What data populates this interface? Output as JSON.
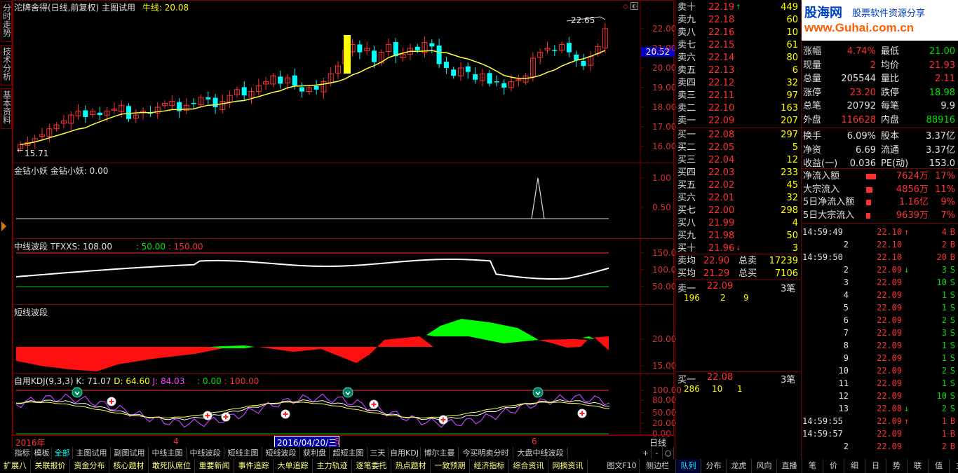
{
  "left_tabs": [
    "分时走势",
    "技术分析",
    "基本资料"
  ],
  "main_panel": {
    "header_stock": "沱牌舍得(日线,前复权)",
    "header_mode": "主图试用",
    "header_ma_label": "牛线:",
    "header_ma_value": "20.08",
    "high_label": "22.65",
    "low_label": "15.71",
    "price_tag": "20.52",
    "y_ticks": [
      "22.00",
      "21.00",
      "20.00",
      "19.00",
      "18.00",
      "17.00",
      "16.00"
    ]
  },
  "panel_jz": {
    "title": "金钻小妖  金钻小妖: 0.00",
    "y_ticks": [
      "1.00",
      "0.50"
    ]
  },
  "panel_mid": {
    "title": "中线波段  TFXXS: 108.00",
    "v1": ": 50.00",
    "v2": ": 150.00",
    "y_ticks": [
      "150.0",
      "100.0",
      "50.00"
    ]
  },
  "panel_short": {
    "title": "短线波段",
    "y_ticks": [
      "20.00",
      "15.00"
    ]
  },
  "panel_kdj": {
    "title": "自用KDJ(9,3,3)",
    "k": "K: 71.07",
    "d": "D: 64.60",
    "j": "J: 84.03",
    "v1": ": 0.00",
    "v2": ": 100.00",
    "y_ticks": [
      "100.00",
      "80.00",
      "50.00",
      "20.00",
      "0.00"
    ]
  },
  "date_axis": {
    "year": "2016年",
    "m4": "4",
    "cursor": "2016/04/20/三",
    "m5": "5",
    "m6": "6",
    "period": "日线"
  },
  "chart_data": {
    "type": "candlestick",
    "approx_close": [
      16.1,
      16.2,
      16.4,
      16.6,
      16.9,
      17.1,
      17.3,
      17.6,
      17.8,
      17.5,
      17.8,
      17.6,
      17.8,
      17.9,
      18.1,
      17.4,
      17.6,
      17.8,
      17.7,
      18.0,
      18.2,
      18.3,
      17.8,
      18.1,
      18.2,
      18.5,
      18.4,
      18.0,
      18.3,
      18.6,
      18.9,
      18.6,
      18.8,
      19.1,
      19.3,
      19.6,
      19.2,
      19.5,
      19.1,
      18.8,
      19.0,
      18.9,
      19.3,
      19.7,
      20.1,
      20.9,
      21.2,
      20.8,
      21.0,
      20.3,
      20.8,
      21.2,
      20.6,
      20.7,
      21.0,
      20.9,
      21.3,
      21.1,
      20.2,
      20.0,
      19.6,
      20.0,
      19.8,
      19.4,
      19.7,
      19.2,
      19.3,
      19.0,
      19.3,
      19.4,
      19.6,
      20.5,
      20.8,
      21.0,
      20.9,
      21.2,
      20.8,
      20.4,
      20.1,
      20.6,
      21.1,
      22.0
    ],
    "ma_label": "牛线",
    "kdj_extremes": {
      "top_markers": 3,
      "bottom_markers": 7
    }
  },
  "orderbook": {
    "sell": [
      {
        "label": "卖十",
        "price": "22.19",
        "vol": "449",
        "arrow": "↑"
      },
      {
        "label": "卖九",
        "price": "22.18",
        "vol": "60"
      },
      {
        "label": "卖八",
        "price": "22.16",
        "vol": "10"
      },
      {
        "label": "卖七",
        "price": "22.15",
        "vol": "61"
      },
      {
        "label": "卖六",
        "price": "22.14",
        "vol": "80"
      },
      {
        "label": "卖五",
        "price": "22.13",
        "vol": "6"
      },
      {
        "label": "卖四",
        "price": "22.12",
        "vol": "32"
      },
      {
        "label": "卖三",
        "price": "22.11",
        "vol": "97"
      },
      {
        "label": "卖二",
        "price": "22.10",
        "vol": "163"
      },
      {
        "label": "卖一",
        "price": "22.09",
        "vol": "207"
      }
    ],
    "buy": [
      {
        "label": "买一",
        "price": "22.08",
        "vol": "297"
      },
      {
        "label": "买二",
        "price": "22.05",
        "vol": "5"
      },
      {
        "label": "买三",
        "price": "22.04",
        "vol": "12"
      },
      {
        "label": "买四",
        "price": "22.03",
        "vol": "233"
      },
      {
        "label": "买五",
        "price": "22.02",
        "vol": "45"
      },
      {
        "label": "买六",
        "price": "22.01",
        "vol": "32"
      },
      {
        "label": "买七",
        "price": "22.00",
        "vol": "298"
      },
      {
        "label": "买八",
        "price": "21.99",
        "vol": "4"
      },
      {
        "label": "买九",
        "price": "21.98",
        "vol": "50"
      },
      {
        "label": "买十",
        "price": "21.96",
        "vol": "3",
        "arrow": "↓"
      }
    ],
    "avg_sell_label": "卖均",
    "avg_sell": "22.90",
    "total_sell_label": "总卖",
    "total_sell": "17239",
    "avg_buy_label": "买均",
    "avg_buy": "21.29",
    "total_buy_label": "总买",
    "total_buy": "7106",
    "queue_sell": {
      "label": "卖一",
      "price": "22.09",
      "count": "3笔",
      "vols": [
        "196",
        "2",
        "9"
      ]
    },
    "queue_buy": {
      "label": "买一",
      "price": "22.08",
      "count": "3笔",
      "vols": [
        "286",
        "10",
        "1"
      ]
    }
  },
  "stats": {
    "logo_text": "股海网",
    "logo_sub": "股票软件资源分享",
    "logo_url": "www.Guhai.com.cn",
    "rows": [
      [
        "涨幅",
        "4.74%",
        "最低",
        "21.00"
      ],
      [
        "现量",
        "2",
        "均价",
        "21.93"
      ],
      [
        "总量",
        "205544",
        "量比",
        "2.11"
      ],
      [
        "涨停",
        "23.20",
        "跌停",
        "18.98"
      ],
      [
        "总笔",
        "20792",
        "每笔",
        "9.9"
      ],
      [
        "外盘",
        "116628",
        "内盘",
        "88916"
      ],
      [
        "换手",
        "6.09%",
        "股本",
        "3.37亿"
      ],
      [
        "净资",
        "6.69",
        "流通",
        "3.37亿"
      ],
      [
        "收益(一)",
        "0.036",
        "PE(动)",
        "153.0"
      ]
    ],
    "flows": [
      {
        "label": "净流入额",
        "value": "7624万",
        "pct": "17%",
        "bar": 0.17
      },
      {
        "label": "大宗流入",
        "value": "4856万",
        "pct": "11%",
        "bar": 0.11
      },
      {
        "label": "5日净流入额",
        "value": "1.16亿",
        "pct": "9%",
        "bar": 0.09
      },
      {
        "label": "5日大宗流入",
        "value": "9639万",
        "pct": "7%",
        "bar": 0.07
      }
    ]
  },
  "ticks": [
    {
      "time": "14:59:49",
      "price": "22.10",
      "arrow": "↑",
      "vol": "4",
      "side": "B"
    },
    {
      "time": "2",
      "price": "22.10",
      "arrow": "",
      "vol": "2",
      "side": "B"
    },
    {
      "time": "14:59:50",
      "price": "22.10",
      "arrow": "",
      "vol": "20",
      "side": "B"
    },
    {
      "time": "2",
      "price": "22.09",
      "arrow": "↓",
      "vol": "3",
      "side": "S"
    },
    {
      "time": "3",
      "price": "22.09",
      "arrow": "",
      "vol": "10",
      "side": "S"
    },
    {
      "time": "4",
      "price": "22.09",
      "arrow": "",
      "vol": "1",
      "side": "S"
    },
    {
      "time": "5",
      "price": "22.09",
      "arrow": "",
      "vol": "1",
      "side": "S"
    },
    {
      "time": "6",
      "price": "22.09",
      "arrow": "",
      "vol": "2",
      "side": "S"
    },
    {
      "time": "7",
      "price": "22.09",
      "arrow": "",
      "vol": "3",
      "side": "S"
    },
    {
      "time": "8",
      "price": "22.09",
      "arrow": "",
      "vol": "1",
      "side": "S"
    },
    {
      "time": "9",
      "price": "22.09",
      "arrow": "",
      "vol": "1",
      "side": "S"
    },
    {
      "time": "10",
      "price": "22.09",
      "arrow": "",
      "vol": "2",
      "side": "S"
    },
    {
      "time": "11",
      "price": "22.09",
      "arrow": "",
      "vol": "1",
      "side": "S"
    },
    {
      "time": "12",
      "price": "22.09",
      "arrow": "",
      "vol": "10",
      "side": "S"
    },
    {
      "time": "13",
      "price": "22.08",
      "arrow": "↓",
      "vol": "2",
      "side": "S"
    },
    {
      "time": "14:59:55",
      "price": "22.09",
      "arrow": "↑",
      "vol": "1",
      "side": "B"
    },
    {
      "time": "14:59:57",
      "price": "22.09",
      "arrow": "",
      "vol": "1",
      "side": "B"
    },
    {
      "time": "2",
      "price": "22.09",
      "arrow": "",
      "vol": "2",
      "side": "B"
    }
  ],
  "indicator_tabs": [
    "指标",
    "模板",
    "全部",
    "主图试用",
    "副图试用",
    "中线主图",
    "中线波段",
    "短线主图",
    "短线波段",
    "获利盘",
    "超短主图",
    "三天",
    "自用KDJ",
    "博尔主曼",
    "今买明卖分时",
    "大盘中线波段"
  ],
  "bottom_tabs": [
    "扩展八",
    "关联报价",
    "资金分布",
    "核心题材",
    "敢死队席位",
    "重要新闻",
    "事件追踪",
    "大单追踪",
    "主力轨迹",
    "逐笔委托",
    "热点题材",
    "一致预期",
    "经济指标",
    "综合资讯",
    "网摘资讯"
  ],
  "bottom_right": [
    "图文F10",
    "侧边栏"
  ],
  "side_tabs": [
    "队列",
    "分布",
    "龙虎",
    "风向",
    "直播",
    "笔",
    "价",
    "细",
    "日",
    "势",
    "联",
    "值",
    "主"
  ],
  "colors": {
    "up": "#ff3030",
    "down": "#00ffff",
    "ma": "#ffff40",
    "border": "#7a0000"
  }
}
